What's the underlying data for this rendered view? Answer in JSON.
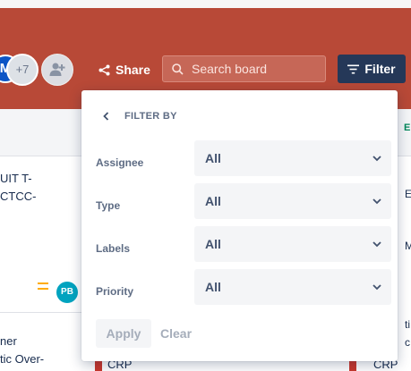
{
  "header": {
    "avatar_initial": "M",
    "extra_members": "+7",
    "share_label": "Share",
    "search_placeholder": "Search board",
    "filter_label": "Filter"
  },
  "board": {
    "card1_text": "UIT T-\nCTCC-",
    "card1_avatar": "PB",
    "card2_text": "ner\ntic Over-",
    "right_frag_1": "E",
    "right_frag_2": "E",
    "right_frag_3": "M",
    "right_frag_4": "ti",
    "right_frag_5": "c",
    "crp_left": "CRP",
    "crp_right": "CRP"
  },
  "filter_panel": {
    "title": "FILTER BY",
    "rows": [
      {
        "label": "Assignee",
        "value": "All"
      },
      {
        "label": "Type",
        "value": "All"
      },
      {
        "label": "Labels",
        "value": "All"
      },
      {
        "label": "Priority",
        "value": "All"
      }
    ],
    "apply_label": "Apply",
    "clear_label": "Clear"
  },
  "colors": {
    "topbar": "#b84937",
    "filter_button": "#253858",
    "priority_medium": "#ffab00",
    "avatar_pb": "#00a3bf"
  }
}
